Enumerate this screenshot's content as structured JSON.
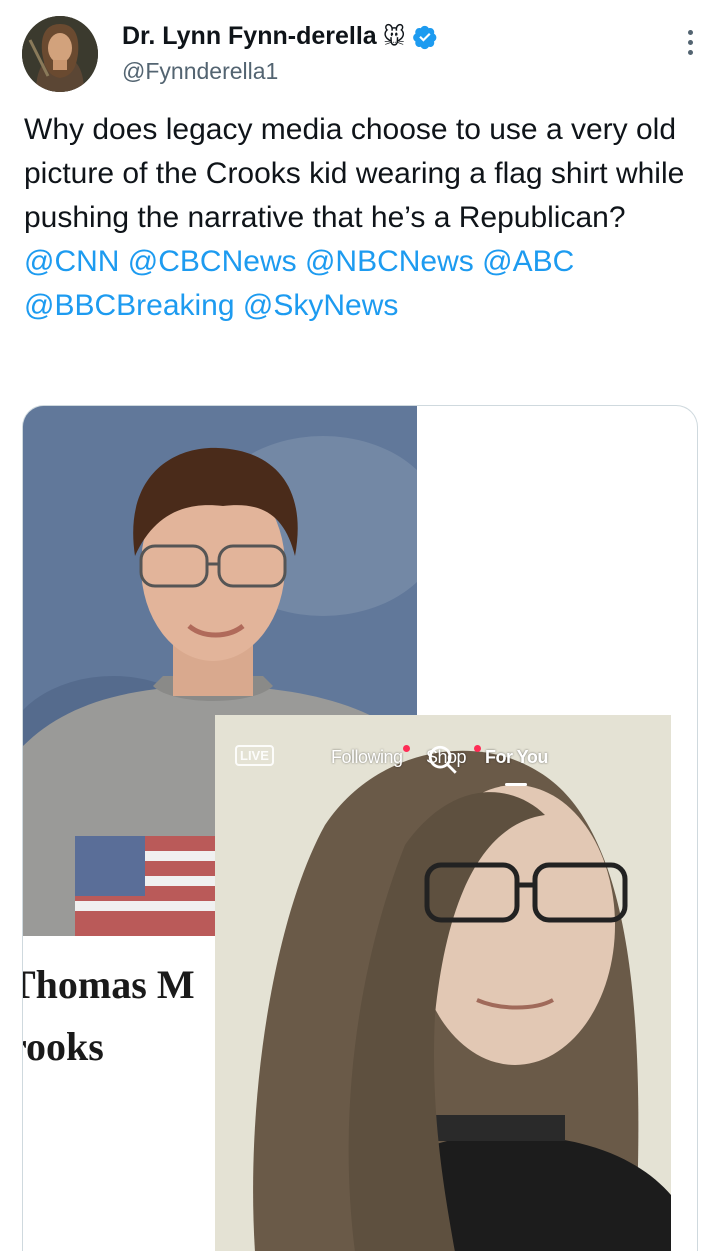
{
  "author": {
    "display_name": "Dr. Lynn Fynn-derella",
    "name_emoji": "🐭",
    "handle": "@Fynnderella1",
    "verified": true,
    "avatar_icon": "avatar-portrait"
  },
  "tweet": {
    "text": "Why does legacy media choose to use a very old picture of the Crooks kid wearing a flag shirt while pushing the narrative that he’s a Republican?",
    "mentions": [
      "@CNN",
      "@CBCNews",
      "@NBCNews",
      "@ABC",
      "@BBCBreaking",
      "@SkyNews"
    ]
  },
  "media": {
    "caption_line1": "Thomas M",
    "caption_line2": "rooks",
    "overlay": {
      "live_label": "LIVE",
      "tabs": [
        "Following",
        "Shop",
        "For You"
      ],
      "active_tab": "For You"
    }
  },
  "colors": {
    "text": "#0f1419",
    "secondary": "#536471",
    "link": "#1d9bf0",
    "verified": "#1d9bf0",
    "border": "#cfd9de"
  }
}
